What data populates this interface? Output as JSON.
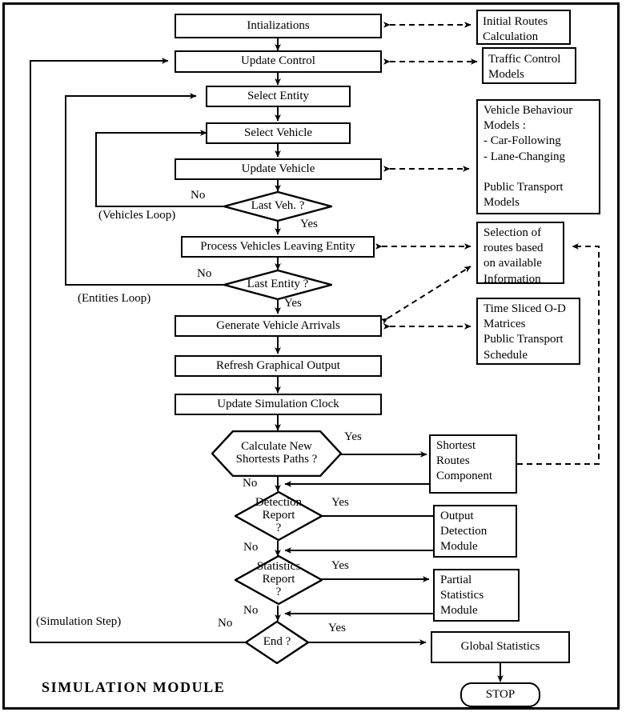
{
  "diagram": {
    "title": "SIMULATION  MODULE",
    "frame_color": "#000000"
  },
  "process_nodes": [
    {
      "id": "initializations",
      "label": "Intializations"
    },
    {
      "id": "update-control",
      "label": "Update Control"
    },
    {
      "id": "select-entity",
      "label": "Select Entity"
    },
    {
      "id": "select-vehicle",
      "label": "Select Vehicle"
    },
    {
      "id": "update-vehicle",
      "label": "Update Vehicle"
    },
    {
      "id": "process-vehicles-leaving-entity",
      "label": "Process Vehicles Leaving Entity"
    },
    {
      "id": "generate-vehicle-arrivals",
      "label": "Generate Vehicle Arrivals"
    },
    {
      "id": "refresh-graphical-output",
      "label": "Refresh Graphical Output"
    },
    {
      "id": "update-simulation-clock",
      "label": "Update Simulation Clock"
    },
    {
      "id": "global-statistics",
      "label": "Global Statistics"
    }
  ],
  "decision_nodes": [
    {
      "id": "last-veh",
      "label": "Last Veh. ?"
    },
    {
      "id": "last-entity",
      "label": "Last Entity ?"
    },
    {
      "id": "calculate-paths",
      "label": "Calculate  New\nShortests Paths ?"
    },
    {
      "id": "detection-report",
      "label": "Detection\nReport\n?"
    },
    {
      "id": "statistics-report",
      "label": "Statistics\nReport\n?"
    },
    {
      "id": "end",
      "label": "End ?"
    }
  ],
  "terminal": {
    "id": "stop",
    "label": "STOP"
  },
  "side_boxes": [
    {
      "id": "initial-routes-calculation",
      "label": "Initial Routes\nCalculation"
    },
    {
      "id": "traffic-control-models",
      "label": "Traffic Control\n      Models"
    },
    {
      "id": "vehicle-behaviour-models",
      "label": "Vehicle Behaviour\nModels :\n  - Car-Following\n  - Lane-Changing\n\nPublic Transport\nModels"
    },
    {
      "id": "selection-of-routes",
      "label": "Selection of\nroutes based\non available\nInformation"
    },
    {
      "id": "time-sliced-od-matrices",
      "label": "Time Sliced O-D\n Matrices\n   Public Transport\n   Schedule"
    },
    {
      "id": "shortest-routes-component",
      "label": "Shortest\nRoutes\nComponent"
    },
    {
      "id": "output-detection-module",
      "label": "Output\nDetection\nModule"
    },
    {
      "id": "partial-statistics-module",
      "label": "Partial\nStatistics\nModule"
    }
  ],
  "edge_labels": [
    {
      "id": "last-veh-no",
      "text": "No"
    },
    {
      "id": "last-veh-yes",
      "text": "Yes"
    },
    {
      "id": "last-entity-no",
      "text": "No"
    },
    {
      "id": "last-entity-yes",
      "text": "Yes"
    },
    {
      "id": "calculate-paths-yes",
      "text": "Yes"
    },
    {
      "id": "calculate-paths-no",
      "text": "No"
    },
    {
      "id": "detection-yes",
      "text": "Yes"
    },
    {
      "id": "detection-no",
      "text": "No"
    },
    {
      "id": "statistics-yes",
      "text": "Yes"
    },
    {
      "id": "statistics-no",
      "text": "No"
    },
    {
      "id": "end-yes",
      "text": "Yes"
    },
    {
      "id": "end-no",
      "text": "No"
    }
  ],
  "loop_labels": [
    {
      "id": "vehicles-loop",
      "text": "(Vehicles Loop)"
    },
    {
      "id": "entities-loop",
      "text": "(Entities Loop)"
    },
    {
      "id": "simulation-step",
      "text": "(Simulation Step)"
    }
  ]
}
